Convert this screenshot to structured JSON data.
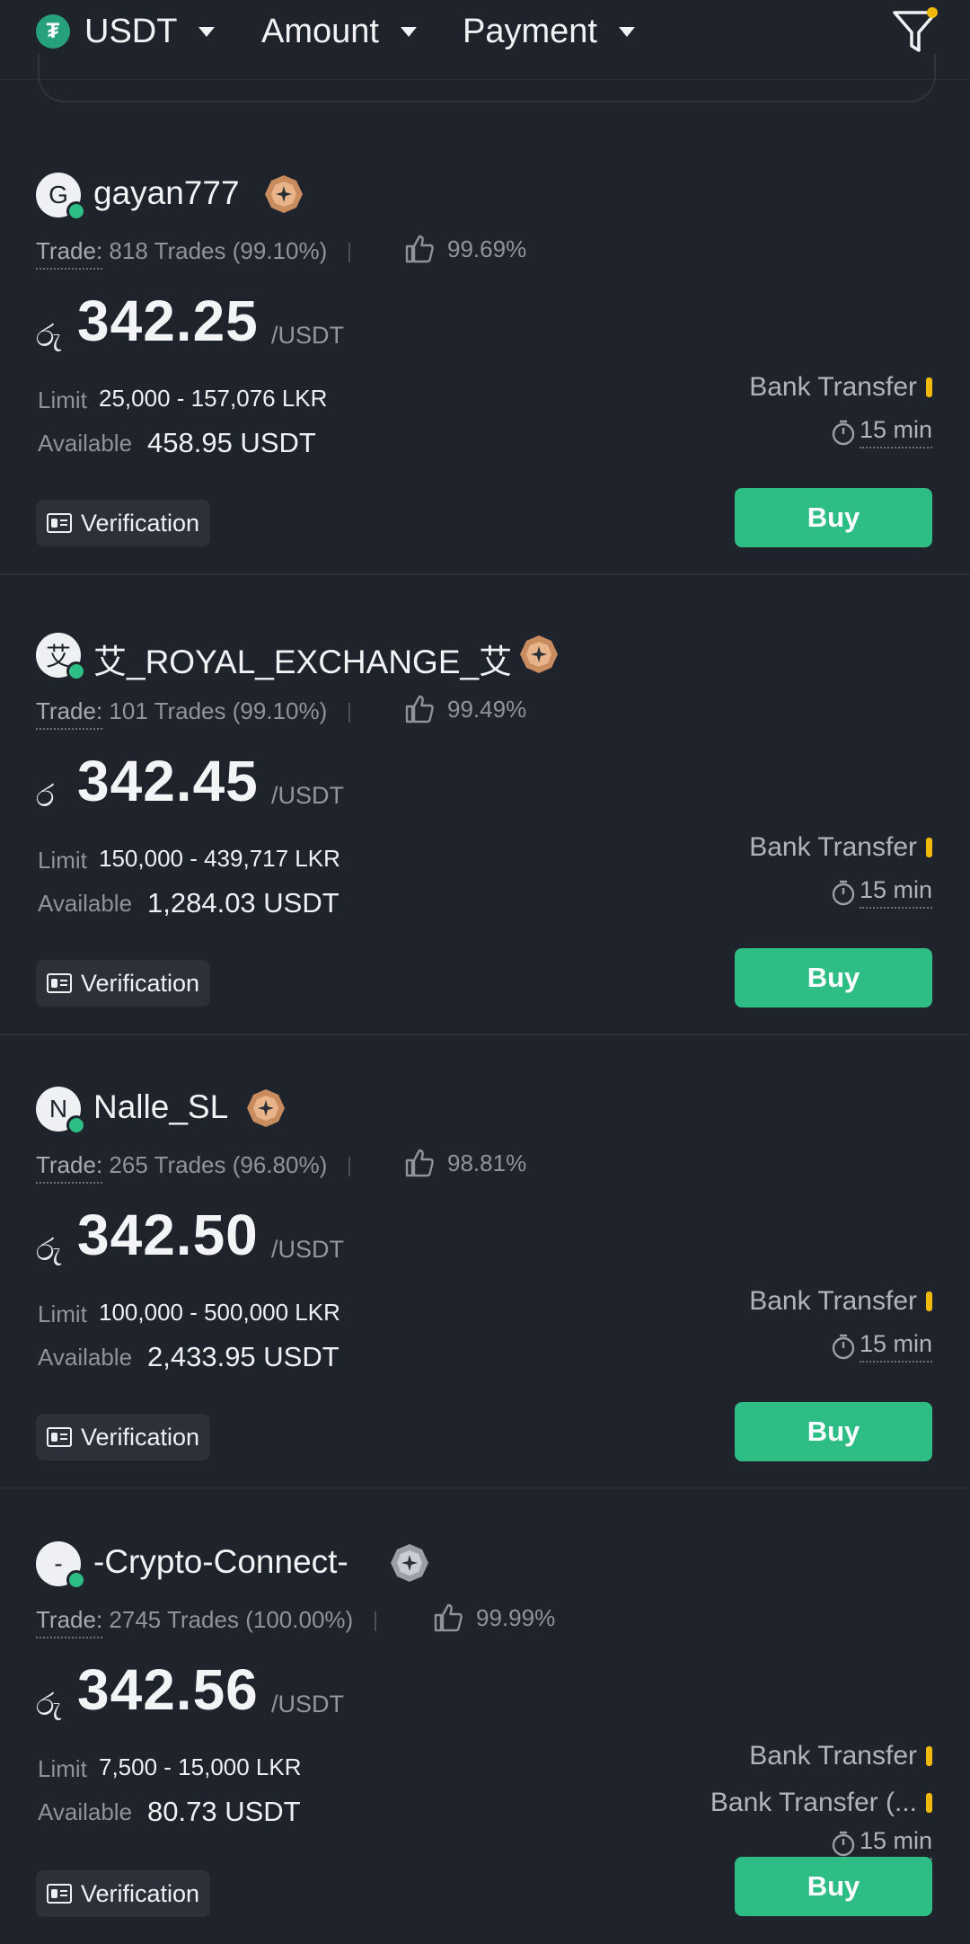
{
  "filters": {
    "coin_label": "USDT",
    "amount_label": "Amount",
    "payment_label": "Payment"
  },
  "colors": {
    "accent": "#2ebd85",
    "warning": "#f0b90b",
    "background": "#1f232b"
  },
  "ads": [
    {
      "avatar_letter": "G",
      "name": "gayan777",
      "badge": "gold-badge-icon",
      "trade_label": "Trade:",
      "trades": "818 Trades",
      "completion": "(99.10%)",
      "positive": "99.69%",
      "currency_symbol": " රු",
      "price": "342.25",
      "unit": "/USDT",
      "limit_label": "Limit",
      "limit": "25,000 - 157,076 LKR",
      "available_label": "Available",
      "available": "458.95 USDT",
      "payments": [
        "Bank Transfer"
      ],
      "time": "15 min",
      "verification_label": "Verification",
      "buy_label": "Buy"
    },
    {
      "avatar_letter": "艾",
      "name": "艾_ROYAL_EXCHANGE_艾",
      "badge": "gold-badge-icon",
      "trade_label": "Trade:",
      "trades": "101 Trades",
      "completion": "(99.10%)",
      "positive": "99.49%",
      "currency_symbol": "ර",
      "price": "342.45",
      "unit": "/USDT",
      "limit_label": "Limit",
      "limit": "150,000 - 439,717 LKR",
      "available_label": "Available",
      "available": "1,284.03 USDT",
      "payments": [
        "Bank Transfer"
      ],
      "time": "15 min",
      "verification_label": "Verification",
      "buy_label": "Buy"
    },
    {
      "avatar_letter": "N",
      "name": "Nalle_SL",
      "badge": "gold-badge-icon",
      "trade_label": "Trade:",
      "trades": "265 Trades",
      "completion": "(96.80%)",
      "positive": "98.81%",
      "currency_symbol": "රු",
      "price": "342.50",
      "unit": "/USDT",
      "limit_label": "Limit",
      "limit": "100,000 - 500,000 LKR",
      "available_label": "Available",
      "available": "2,433.95 USDT",
      "payments": [
        "Bank Transfer"
      ],
      "time": "15 min",
      "verification_label": "Verification",
      "buy_label": "Buy"
    },
    {
      "avatar_letter": "-",
      "name": "-Crypto-Connect-",
      "badge": "silver-badge-icon",
      "trade_label": "Trade:",
      "trades": "2745 Trades",
      "completion": "(100.00%)",
      "positive": "99.99%",
      "currency_symbol": "රු",
      "price": "342.56",
      "unit": "/USDT",
      "limit_label": "Limit",
      "limit": "7,500 - 15,000 LKR",
      "available_label": "Available",
      "available": "80.73 USDT",
      "payments": [
        "Bank Transfer",
        "Bank Transfer (..."
      ],
      "time": "15 min",
      "verification_label": "Verification",
      "buy_label": "Buy"
    }
  ]
}
